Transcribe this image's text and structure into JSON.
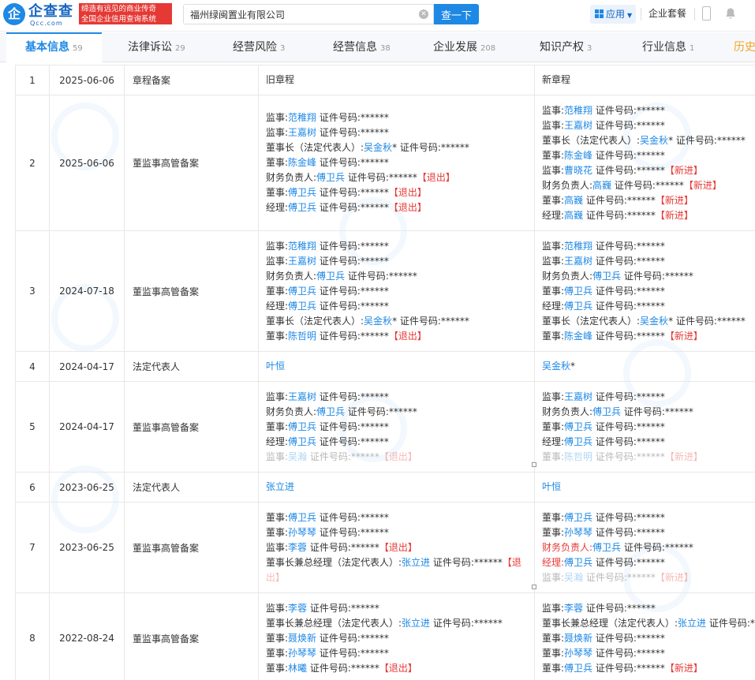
{
  "header": {
    "logo_mark": "企",
    "logo_name": "企查查",
    "logo_domain": "Qcc.com",
    "slogan_line1": "缔造有远见的商业传奇",
    "slogan_line2": "全国企业信用查询系统",
    "search_value": "福州绿闽置业有限公司",
    "search_button": "查一下",
    "apps_label": "应用",
    "package_label": "企业套餐"
  },
  "tabs": [
    {
      "label": "基本信息",
      "count": "59"
    },
    {
      "label": "法律诉讼",
      "count": "29"
    },
    {
      "label": "经营风险",
      "count": "3"
    },
    {
      "label": "经营信息",
      "count": "38"
    },
    {
      "label": "企业发展",
      "count": "208"
    },
    {
      "label": "知识产权",
      "count": "3"
    },
    {
      "label": "行业信息",
      "count": "1"
    },
    {
      "label": "历史",
      "count": ""
    }
  ],
  "rows": [
    {
      "no": "1",
      "date": "2025-06-06",
      "type": "章程备案",
      "old": [
        {
          "plain": "旧章程"
        }
      ],
      "new": [
        {
          "plain": "新章程"
        }
      ]
    },
    {
      "no": "2",
      "date": "2025-06-06",
      "type": "董监事高管备案",
      "old": [
        {
          "role": "监事:",
          "name": "范稚翔",
          "suffix": " 证件号码:******"
        },
        {
          "role": "监事:",
          "name": "王嘉树",
          "suffix": " 证件号码:******"
        },
        {
          "role": "董事长（法定代表人）:",
          "name": "吴金秋",
          "suffix": "* 证件号码:******"
        },
        {
          "role": "董事:",
          "name": "陈金峰",
          "suffix": " 证件号码:******"
        },
        {
          "role": "财务负责人:",
          "name": "傅卫兵",
          "suffix": " 证件号码:******",
          "tag": "【退出】"
        },
        {
          "role": "董事:",
          "name": "傅卫兵",
          "suffix": " 证件号码:******",
          "tag": "【退出】"
        },
        {
          "role": "经理:",
          "name": "傅卫兵",
          "suffix": " 证件号码:******",
          "tag": "【退出】"
        }
      ],
      "new": [
        {
          "role": "监事:",
          "name": "范稚翔",
          "suffix": " 证件号码:******"
        },
        {
          "role": "监事:",
          "name": "王嘉树",
          "suffix": " 证件号码:******"
        },
        {
          "role": "董事长（法定代表人）:",
          "name": "吴金秋",
          "suffix": "* 证件号码:******"
        },
        {
          "role": "董事:",
          "name": "陈金峰",
          "suffix": " 证件号码:******"
        },
        {
          "role": "监事:",
          "name": "曹晓花",
          "suffix": " 证件号码:******",
          "tag": "【新进】"
        },
        {
          "role": "财务负责人:",
          "name": "高巍",
          "suffix": " 证件号码:******",
          "tag": "【新进】"
        },
        {
          "role": "董事:",
          "name": "高巍",
          "suffix": " 证件号码:******",
          "tag": "【新进】"
        },
        {
          "role": "经理:",
          "name": "高巍",
          "suffix": " 证件号码:******",
          "tag": "【新进】"
        }
      ]
    },
    {
      "no": "3",
      "date": "2024-07-18",
      "type": "董监事高管备案",
      "old": [
        {
          "role": "监事:",
          "name": "范稚翔",
          "suffix": " 证件号码:******"
        },
        {
          "role": "监事:",
          "name": "王嘉树",
          "suffix": " 证件号码:******"
        },
        {
          "role": "财务负责人:",
          "name": "傅卫兵",
          "suffix": " 证件号码:******"
        },
        {
          "role": "董事:",
          "name": "傅卫兵",
          "suffix": " 证件号码:******"
        },
        {
          "role": "经理:",
          "name": "傅卫兵",
          "suffix": " 证件号码:******"
        },
        {
          "role": "董事长（法定代表人）:",
          "name": "吴金秋",
          "suffix": "* 证件号码:******"
        },
        {
          "role": "董事:",
          "name": "陈哲明",
          "suffix": " 证件号码:******",
          "tag": "【退出】"
        }
      ],
      "new": [
        {
          "role": "监事:",
          "name": "范稚翔",
          "suffix": " 证件号码:******"
        },
        {
          "role": "监事:",
          "name": "王嘉树",
          "suffix": " 证件号码:******"
        },
        {
          "role": "财务负责人:",
          "name": "傅卫兵",
          "suffix": " 证件号码:******"
        },
        {
          "role": "董事:",
          "name": "傅卫兵",
          "suffix": " 证件号码:******"
        },
        {
          "role": "经理:",
          "name": "傅卫兵",
          "suffix": " 证件号码:******"
        },
        {
          "role": "董事长（法定代表人）:",
          "name": "吴金秋",
          "suffix": "* 证件号码:******"
        },
        {
          "role": "董事:",
          "name": "陈金峰",
          "suffix": " 证件号码:******",
          "tag": "【新进】"
        }
      ]
    },
    {
      "no": "4",
      "date": "2024-04-17",
      "type": "法定代表人",
      "old": [
        {
          "role": "",
          "name": "叶恒",
          "suffix": ""
        }
      ],
      "new": [
        {
          "role": "",
          "name": "吴金秋",
          "suffix": "*"
        }
      ]
    },
    {
      "no": "5",
      "date": "2024-04-17",
      "type": "董监事高管备案",
      "old": [
        {
          "role": "监事:",
          "name": "王嘉树",
          "suffix": " 证件号码:******"
        },
        {
          "role": "财务负责人:",
          "name": "傅卫兵",
          "suffix": " 证件号码:******"
        },
        {
          "role": "董事:",
          "name": "傅卫兵",
          "suffix": " 证件号码:******"
        },
        {
          "role": "经理:",
          "name": "傅卫兵",
          "suffix": " 证件号码:******"
        },
        {
          "role": "监事:",
          "name": "吴瀚",
          "suffix": " 证件号码:******",
          "tag": "【退出】",
          "fade": true
        }
      ],
      "new": [
        {
          "role": "监事:",
          "name": "王嘉树",
          "suffix": " 证件号码:******"
        },
        {
          "role": "财务负责人:",
          "name": "傅卫兵",
          "suffix": " 证件号码:******"
        },
        {
          "role": "董事:",
          "name": "傅卫兵",
          "suffix": " 证件号码:******"
        },
        {
          "role": "经理:",
          "name": "傅卫兵",
          "suffix": " 证件号码:******"
        },
        {
          "role": "董事:",
          "name": "陈哲明",
          "suffix": " 证件号码:******",
          "tag": "【新进】",
          "fade": true
        }
      ]
    },
    {
      "no": "6",
      "date": "2023-06-25",
      "type": "法定代表人",
      "old": [
        {
          "role": "",
          "name": "张立进",
          "suffix": ""
        }
      ],
      "new": [
        {
          "role": "",
          "name": "叶恒",
          "suffix": ""
        }
      ]
    },
    {
      "no": "7",
      "date": "2023-06-25",
      "type": "董监事高管备案",
      "old": [
        {
          "role": "董事:",
          "name": "傅卫兵",
          "suffix": " 证件号码:******"
        },
        {
          "role": "董事:",
          "name": "孙琴琴",
          "suffix": " 证件号码:******"
        },
        {
          "role": "监事:",
          "name": "李蓉",
          "suffix": " 证件号码:******",
          "tag": "【退出】"
        },
        {
          "role": "董事长兼总经理（法定代表人）:",
          "name": "张立进",
          "suffix": " 证件号码:******",
          "tag": "【退"
        },
        {
          "role": "",
          "name": "",
          "suffix": "",
          "tag": "出】",
          "fade": true
        }
      ],
      "new": [
        {
          "role": "董事:",
          "name": "傅卫兵",
          "suffix": " 证件号码:******"
        },
        {
          "role": "董事:",
          "name": "孙琴琴",
          "suffix": " 证件号码:******"
        },
        {
          "role": "财务负责人:",
          "name": "傅卫兵",
          "suffix": " 证件号码:******",
          "redrole": true
        },
        {
          "role": "经理:",
          "name": "傅卫兵",
          "suffix": " 证件号码:******",
          "redrole": true
        },
        {
          "role": "监事:",
          "name": "吴瀚",
          "suffix": " 证件号码:******",
          "tag": "【新进】",
          "fade": true
        }
      ]
    },
    {
      "no": "8",
      "date": "2022-08-24",
      "type": "董监事高管备案",
      "old": [
        {
          "role": "监事:",
          "name": "李蓉",
          "suffix": " 证件号码:******"
        },
        {
          "role": "董事长兼总经理（法定代表人）:",
          "name": "张立进",
          "suffix": " 证件号码:******"
        },
        {
          "role": "董事:",
          "name": "聂焕新",
          "suffix": " 证件号码:******"
        },
        {
          "role": "董事:",
          "name": "孙琴琴",
          "suffix": " 证件号码:******"
        },
        {
          "role": "董事:",
          "name": "林曦",
          "suffix": " 证件号码:******",
          "tag": "【退出】"
        }
      ],
      "new": [
        {
          "role": "监事:",
          "name": "李蓉",
          "suffix": " 证件号码:******"
        },
        {
          "role": "董事长兼总经理（法定代表人）:",
          "name": "张立进",
          "suffix": " 证件号码:**"
        },
        {
          "role": "董事:",
          "name": "聂焕新",
          "suffix": " 证件号码:******"
        },
        {
          "role": "董事:",
          "name": "孙琴琴",
          "suffix": " 证件号码:******"
        },
        {
          "role": "董事:",
          "name": "傅卫兵",
          "suffix": " 证件号码:******",
          "tag": "【新进】"
        }
      ]
    }
  ],
  "colors": {
    "accent": "#1e88e5",
    "exit": "#e53935",
    "history_tab": "#f5a623"
  }
}
